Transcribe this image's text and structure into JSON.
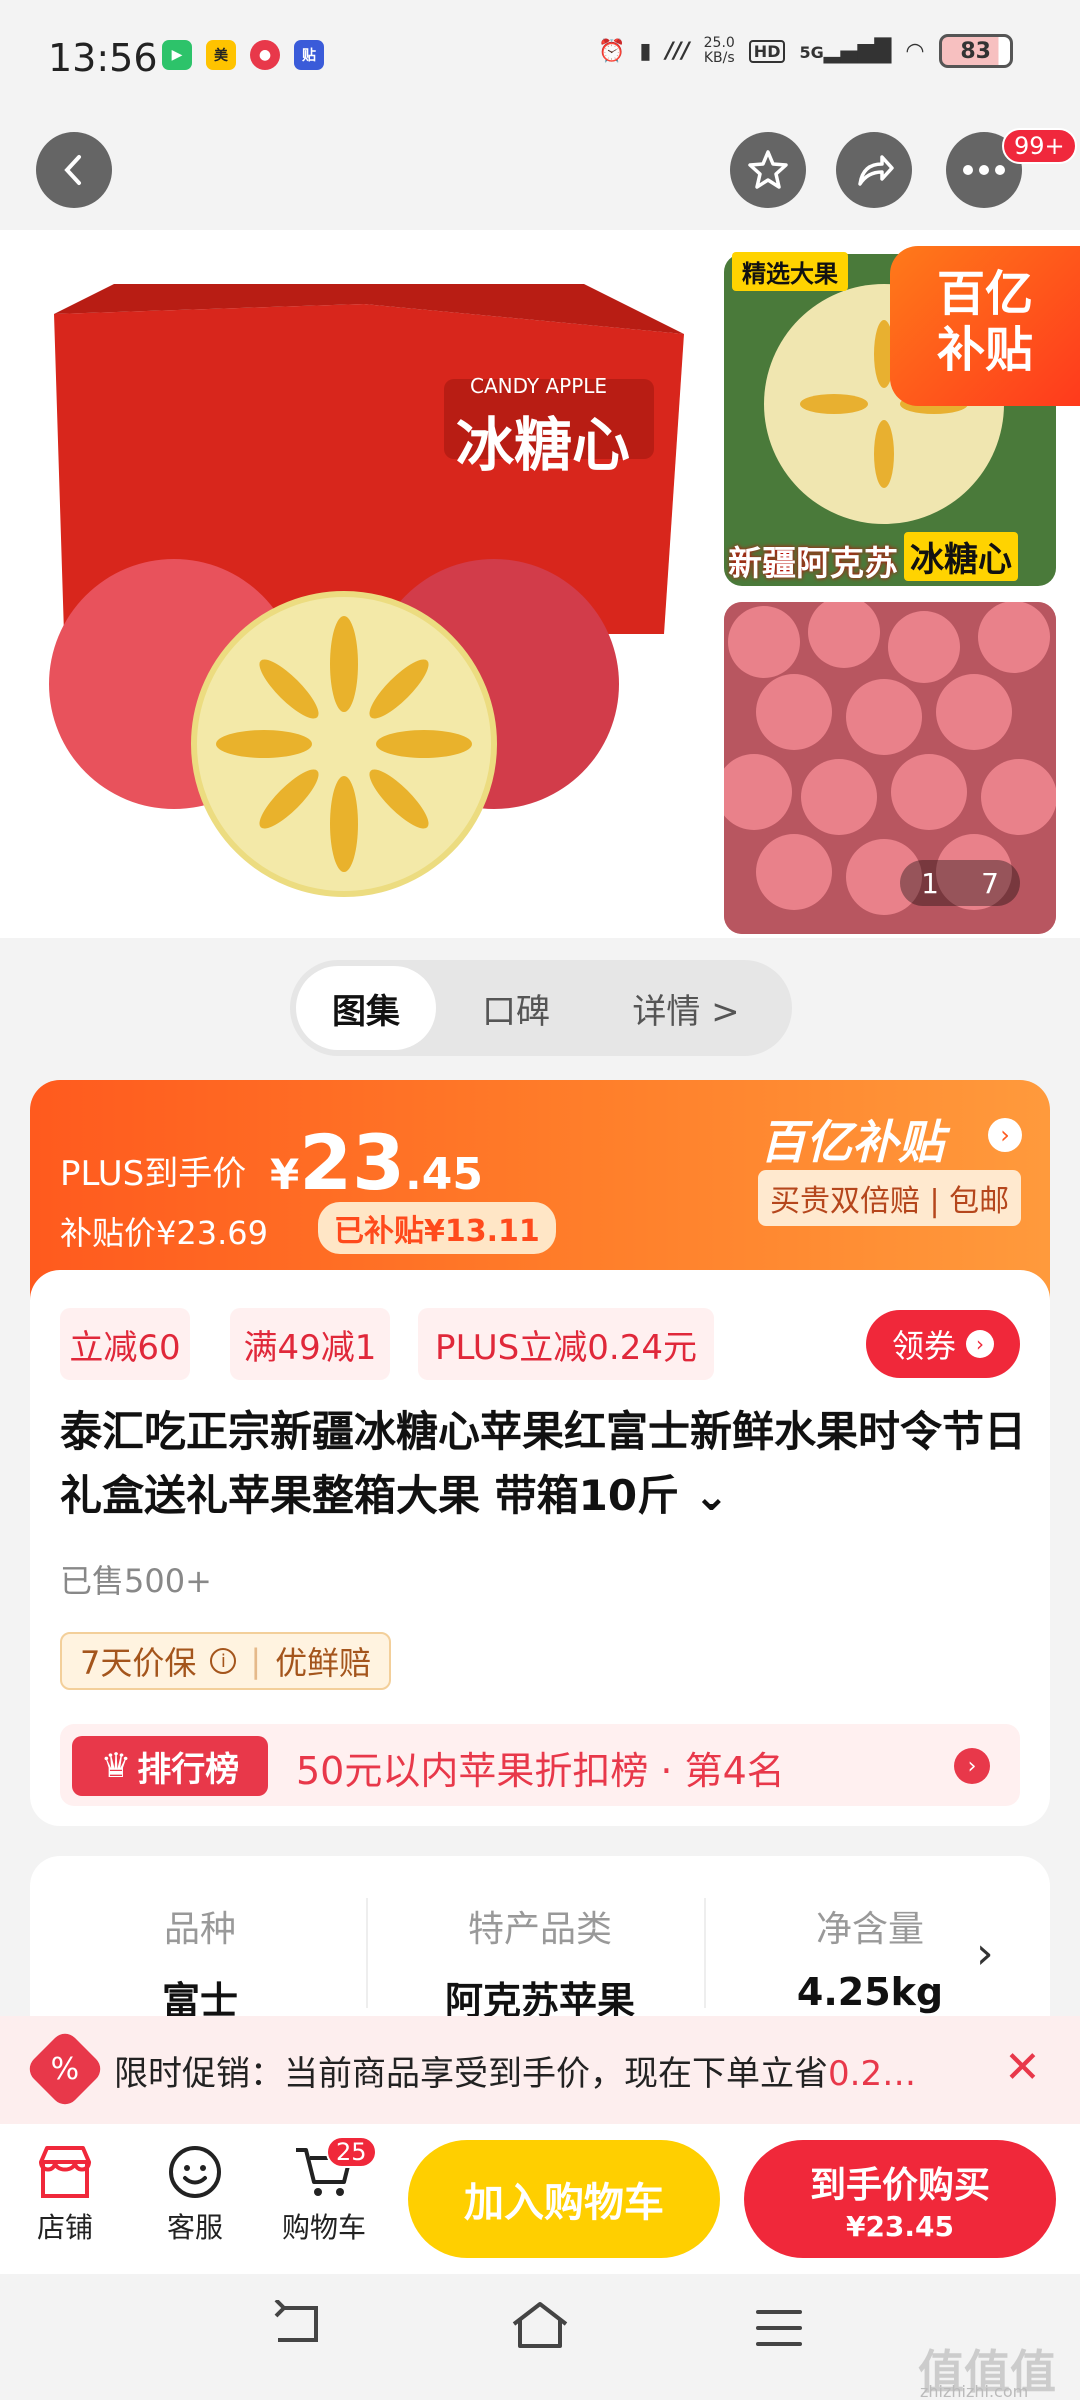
{
  "status_bar": {
    "time": "13:56",
    "net_speed_value": "25.0",
    "net_speed_unit": "KB/s",
    "network": "5G",
    "battery": "83"
  },
  "top_nav": {
    "more_badge": "99+"
  },
  "gallery": {
    "main_box_text": "冰糖心",
    "main_box_sub": "CANDY APPLE",
    "thumb1_tag": "精选大果",
    "thumb1_caption_a": "新疆阿克苏",
    "thumb1_caption_b": "冰糖心",
    "subsidy_line1": "百亿",
    "subsidy_line2": "补贴",
    "pager_current": "1",
    "pager_total": "7"
  },
  "tabs": [
    {
      "label": "图集",
      "active": true
    },
    {
      "label": "口碑",
      "active": false
    },
    {
      "label": "详情 >",
      "active": false
    }
  ],
  "price": {
    "plus_label": "PLUS到手价",
    "currency": "¥",
    "integer": "23",
    "decimal": ".45",
    "subsidy_price": "补贴价¥23.69",
    "subsidized_amount": "已补贴¥13.11",
    "brand": "百亿补贴",
    "guarantee": "买贵双倍赔 | 包邮"
  },
  "promos": {
    "chip1": "立减60",
    "chip2": "满49减1",
    "chip3": "PLUS立减0.24元",
    "coupon_button": "领券"
  },
  "product": {
    "title": "泰汇吃正宗新疆冰糖心苹果红富士新鲜水果时令节日礼盒送礼苹果整箱大果 带箱10斤 ⌄",
    "sold": "已售500+",
    "guarantee_a": "7天价保",
    "guarantee_b": "优鲜赔",
    "rank_tag": "排行榜",
    "rank_text": "50元以内苹果折扣榜 · 第4名"
  },
  "specs": [
    {
      "label": "品种",
      "value": "富士"
    },
    {
      "label": "特产品类",
      "value": "阿克苏苹果"
    },
    {
      "label": "净含量",
      "value": "4.25kg"
    }
  ],
  "promo_strip": {
    "text": "限时促销：当前商品享受到手价，现在下单立省",
    "highlight": "0.2…"
  },
  "bottom_bar": {
    "store": "店铺",
    "service": "客服",
    "cart": "购物车",
    "cart_badge": "25",
    "add_to_cart": "加入购物车",
    "buy_label": "到手价购买",
    "buy_price": "¥23.45"
  },
  "watermark": {
    "main": "值值值",
    "sub": "zhizhizhi.com"
  },
  "colors": {
    "accent_red": "#f0283a",
    "accent_orange": "#ff5a1e",
    "cart_yellow": "#ffcf00"
  }
}
